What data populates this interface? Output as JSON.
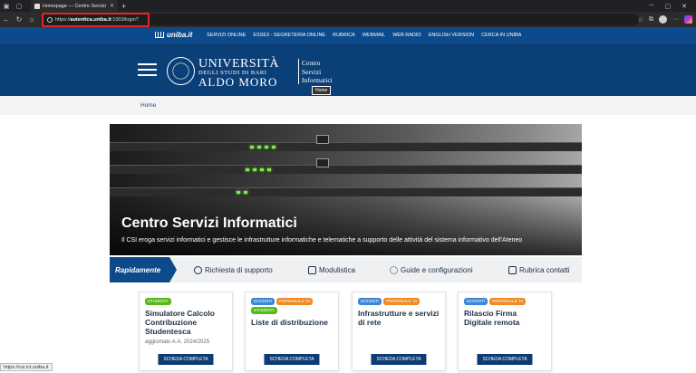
{
  "browser": {
    "tab_title": "Homepage — Centro Servizi Infor...",
    "new_tab": "+",
    "url_prefix": "https://",
    "url_host": "autentica.uniba.it",
    "url_path": ":1003/login?",
    "status_url": "https://csi.ict.uniba.it"
  },
  "topnav": {
    "logo": "uniba.it",
    "links": [
      "SERVIZI ONLINE",
      "ESSE3 - SEGRETERIA ONLINE",
      "RUBRICA",
      "WEBMAIL",
      "WEB RADIO",
      "ENGLISH VERSION",
      "CERCA IN UNIBA"
    ]
  },
  "header": {
    "uni_line1": "UNIVERSITÀ",
    "uni_line2": "DEGLI STUDI DI BARI",
    "uni_line3": "ALDO MORO",
    "csi_line1": "Centro",
    "csi_line2": "Servizi",
    "csi_line3": "Informatici",
    "tooltip": "Home"
  },
  "breadcrumb": {
    "home": "Home"
  },
  "hero": {
    "title": "Centro Servizi Informatici",
    "subtitle": "Il CSI eroga servizi informatici e gestisce le infrastrutture informatiche e telematiche a supporto delle attività del sistema informativo dell'Ateneo"
  },
  "quick": {
    "label": "Rapidamente",
    "links": [
      "Richiesta di supporto",
      "Modulistica",
      "Guide e configurazioni",
      "Rubrica contatti"
    ]
  },
  "cards": [
    {
      "tags": [
        "STUDENTI"
      ],
      "title": "Simulatore Calcolo Contribuzione Studentesca",
      "note": "aggiornato A.A. 2024/2025",
      "button": "SCHEDA COMPLETA"
    },
    {
      "tags": [
        "DOCENTI",
        "PERSONALE TA",
        "STUDENTI"
      ],
      "title": "Liste di distribuzione",
      "note": "",
      "button": "SCHEDA COMPLETA"
    },
    {
      "tags": [
        "DOCENTI",
        "PERSONALE TA"
      ],
      "title": "Infrastrutture e servizi di rete",
      "note": "",
      "button": "SCHEDA COMPLETA"
    },
    {
      "tags": [
        "DOCENTI",
        "PERSONALE TA"
      ],
      "title": "Rilascio Firma Digitale remota",
      "note": "",
      "button": "SCHEDA COMPLETA"
    }
  ],
  "colors": {
    "brand_blue": "#0d4a8b",
    "header_blue": "#0b3f78",
    "tag_green": "#56b81b",
    "tag_blue": "#3c85d8",
    "tag_orange": "#f08a24",
    "highlight_red": "#e0262c"
  }
}
